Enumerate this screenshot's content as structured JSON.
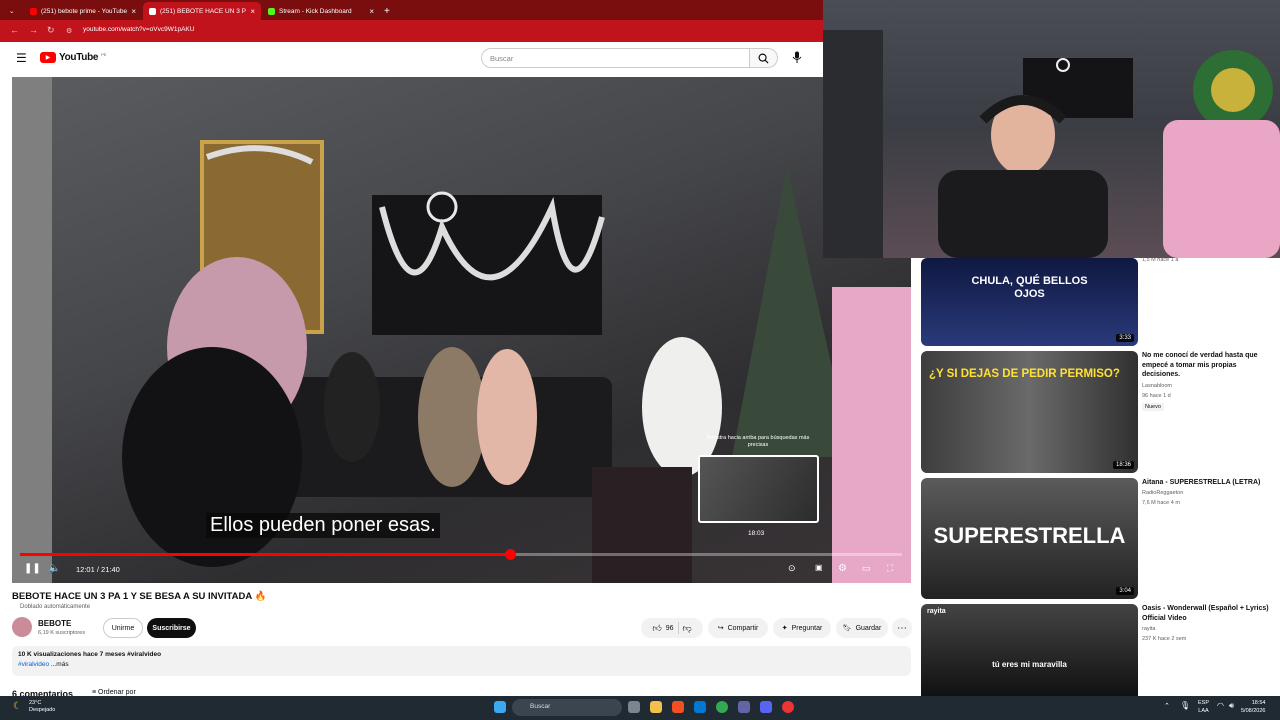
{
  "browser": {
    "tabs": [
      {
        "label": "(251) bebote prime - YouTube",
        "active": false
      },
      {
        "label": "(251) BEBOTE HACE UN 3 P",
        "active": true
      },
      {
        "label": "Stream - Kick Dashboard",
        "active": false
      }
    ],
    "url": "youtube.com/watch?v=oVvc9W1pAKU"
  },
  "youtube": {
    "logo": "YouTube",
    "region": "PE",
    "search_placeholder": "Buscar"
  },
  "player": {
    "subtitle": "Ellos pueden poner esas.",
    "time": "12:01 / 21:40",
    "progress": 0.555,
    "drag_tip": "Arrastra hacia arriba para búsquedas más precisas",
    "preview_time": "18:03"
  },
  "video": {
    "title": "BEBOTE HACE UN 3 PA 1 Y SE BESA A SU INVITADA 🔥",
    "dubbed": "Doblado automáticamente",
    "channel": "BEBOTE",
    "subscribers": "6,19 K suscriptores",
    "join": "Unirme",
    "subscribe": "Suscribirse",
    "likes": "96",
    "share": "Compartir",
    "ask": "Preguntar",
    "save": "Guardar",
    "views": "10 K visualizaciones  hace 7 meses  #viralvideo",
    "hashtag": "#viralvideo",
    "more": "...más",
    "comments": "6 comentarios",
    "sort": "Ordenar por"
  },
  "recommendations": [
    {
      "thumb_text": "CHULA, QUÉ BELLOS OJOS",
      "duration": "3:33",
      "meta": "1,5 M  hace 1 a"
    },
    {
      "thumb_text": "¿Y SI DEJAS DE PEDIR PERMISO?",
      "duration": "18:36",
      "title": "No me conocí de verdad hasta que empecé a tomar mis propias decisiones.",
      "channel": "Lasnabloom",
      "meta": "96  hace 1 d",
      "badge": "Nuevo"
    },
    {
      "thumb_text": "SUPERESTRELLA",
      "duration": "3:04",
      "title": "Aitana - SUPERESTRELLA (LETRA)",
      "channel": "RadioReggaeton",
      "meta": "7,6 M  hace 4 m"
    },
    {
      "thumb_text": "tú eres mi maravilla",
      "thumb_channel": "rayita",
      "title": "Oasis - Wonderwall (Español + Lyrics) Official Video",
      "channel": "rayita",
      "meta": "237 K  hace 2 sem"
    }
  ],
  "taskbar": {
    "temp": "23°C",
    "weather": "Despejado",
    "search": "Buscar",
    "lang": "ESP",
    "lang2": "LAA",
    "time": "18:54",
    "date": "5/08/2026"
  }
}
